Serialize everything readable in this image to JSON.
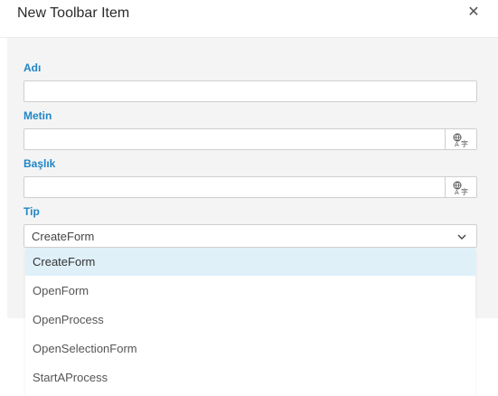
{
  "dialog": {
    "title": "New Toolbar Item",
    "close_icon": "close-icon"
  },
  "fields": {
    "name": {
      "label": "Adı",
      "value": ""
    },
    "text": {
      "label": "Metin",
      "value": "",
      "button_icon": "translate-icon"
    },
    "caption": {
      "label": "Başlık",
      "value": "",
      "button_icon": "translate-icon"
    },
    "type": {
      "label": "Tip",
      "value": "CreateForm",
      "options": [
        "CreateForm",
        "OpenForm",
        "OpenProcess",
        "OpenSelectionForm",
        "StartAProcess"
      ]
    }
  },
  "colors": {
    "label": "#1f86c8",
    "selected_option_bg": "#dff0f9",
    "body_bg": "#f4f4f4"
  }
}
